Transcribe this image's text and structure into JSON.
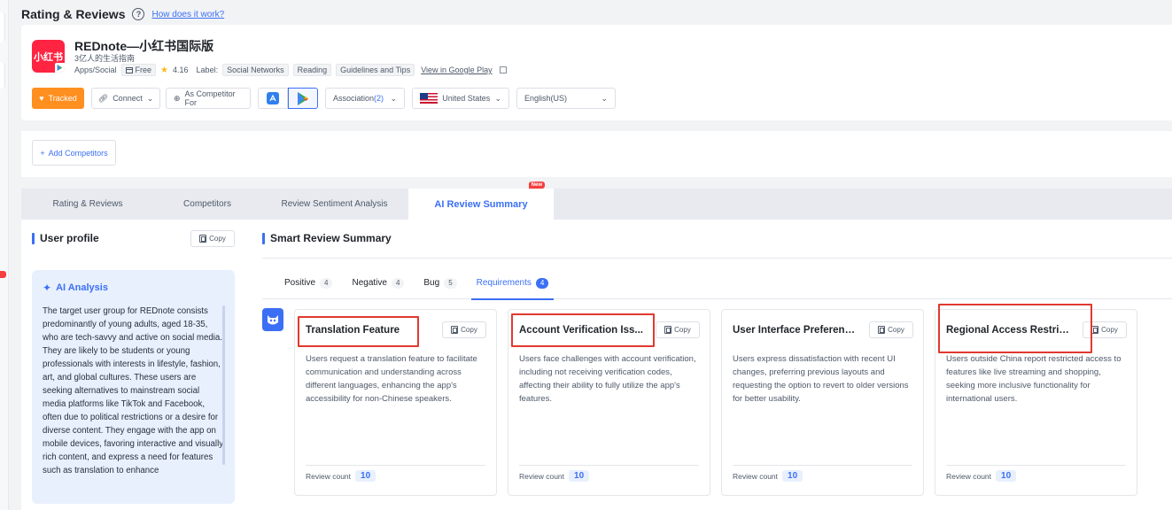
{
  "page": {
    "title": "Rating & Reviews",
    "help_link": "How does it work?"
  },
  "app": {
    "icon_text": "小红书",
    "name": "REDnote—小红书国际版",
    "slogan": "3亿人的生活指南",
    "category": "Apps/Social",
    "price": "Free",
    "rating": "4.16",
    "label_prefix": "Label:",
    "labels": [
      "Social Networks",
      "Reading",
      "Guidelines and Tips"
    ],
    "store_link": "View in Google Play"
  },
  "toolbar": {
    "tracked": "Tracked",
    "connect": "Connect",
    "as_competitor": "As Competitor For",
    "association": "Association",
    "association_count": "(2)",
    "country": "United States",
    "language": "English(US)",
    "add_competitors": "Add Competitors"
  },
  "tabs": [
    {
      "label": "Rating & Reviews"
    },
    {
      "label": "Competitors"
    },
    {
      "label": "Review Sentiment Analysis"
    },
    {
      "label": "AI Review Summary",
      "badge": "New"
    }
  ],
  "user_profile": {
    "title": "User profile",
    "copy": "Copy",
    "ai_title": "AI Analysis",
    "text": "The target user group for REDnote consists predominantly of young adults, aged 18-35, who are tech-savvy and active on social media. They are likely to be students or young professionals with interests in lifestyle, fashion, art, and global cultures. These users are seeking alternatives to mainstream social media platforms like TikTok and Facebook, often due to political restrictions or a desire for diverse content. They engage with the app on mobile devices, favoring interactive and visually rich content, and express a need for features such as translation to enhance"
  },
  "summary": {
    "title": "Smart Review Summary",
    "sub_tabs": [
      {
        "label": "Positive",
        "count": "4"
      },
      {
        "label": "Negative",
        "count": "4"
      },
      {
        "label": "Bug",
        "count": "5"
      },
      {
        "label": "Requirements",
        "count": "4"
      }
    ],
    "cards": [
      {
        "title": "Translation Feature",
        "copy": "Copy",
        "desc": "Users request a translation feature to facilitate communication and understanding across different languages, enhancing the app's accessibility for non-Chinese speakers.",
        "review_label": "Review count",
        "review_count": "10"
      },
      {
        "title": "Account Verification Iss...",
        "copy": "Copy",
        "desc": "Users face challenges with account verification, including not receiving verification codes, affecting their ability to fully utilize the app's features.",
        "review_label": "Review count",
        "review_count": "10"
      },
      {
        "title": "User Interface Preferenc...",
        "copy": "Copy",
        "desc": "Users express dissatisfaction with recent UI changes, preferring previous layouts and requesting the option to revert to older versions for better usability.",
        "review_label": "Review count",
        "review_count": "10"
      },
      {
        "title": "Regional Access Restric...",
        "copy": "Copy",
        "desc": "Users outside China report restricted access to features like live streaming and shopping, seeking more inclusive functionality for international users.",
        "review_label": "Review count",
        "review_count": "10"
      }
    ]
  },
  "colors": {
    "accent": "#3b6ff5",
    "tracked": "#ff8f1f",
    "brand": "#ff2442",
    "highlight": "#e0392f"
  },
  "icons": [
    "help-icon",
    "heart-icon",
    "link-icon",
    "plus-circle-icon",
    "app-store-icon",
    "google-play-icon",
    "us-flag-icon",
    "chevron-down-icon",
    "plus-icon",
    "copy-icon",
    "sparkle-icon",
    "bot-icon",
    "star-icon",
    "external-link-icon"
  ]
}
